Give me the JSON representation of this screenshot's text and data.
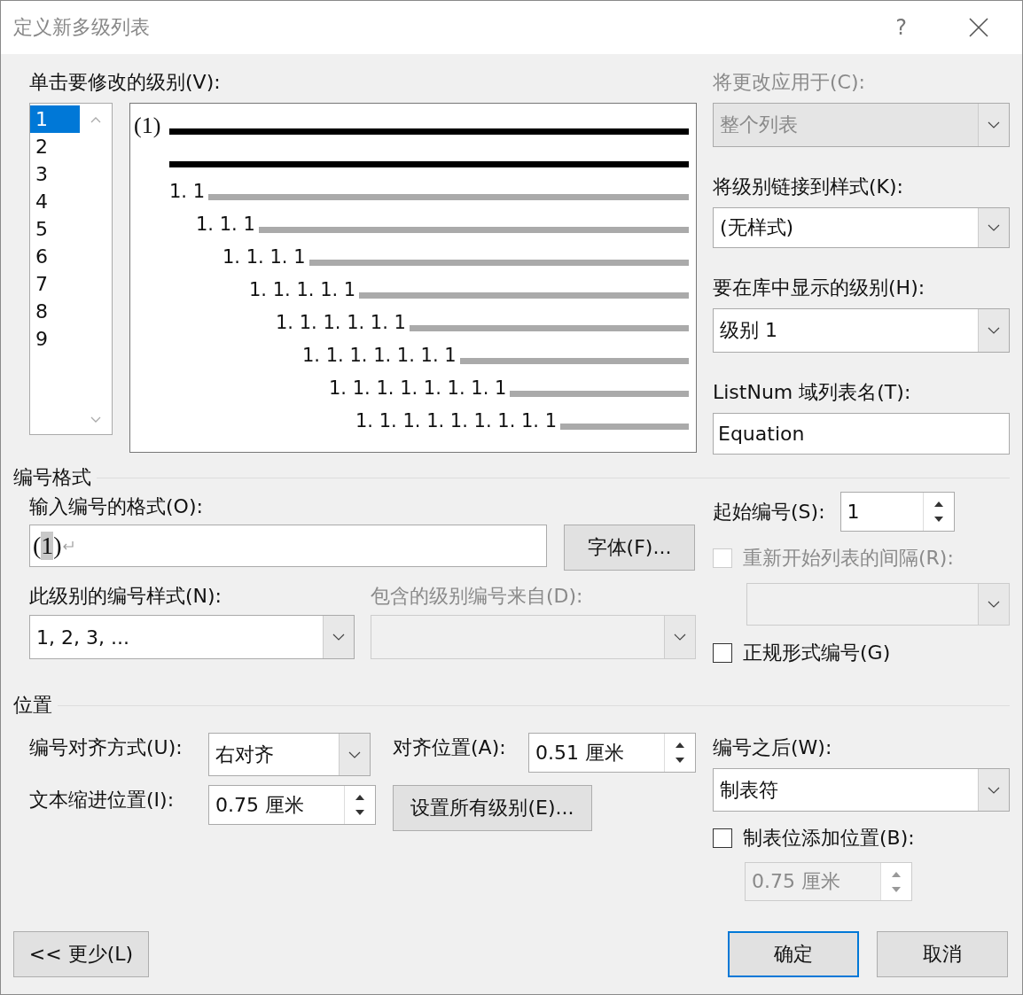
{
  "window": {
    "title": "定义新多级列表",
    "help": "?"
  },
  "level_picker": {
    "label": "单击要修改的级别(V):",
    "levels": [
      {
        "label": "1",
        "selected": true
      },
      {
        "label": "2",
        "selected": false
      },
      {
        "label": "3",
        "selected": false
      },
      {
        "label": "4",
        "selected": false
      },
      {
        "label": "5",
        "selected": false
      },
      {
        "label": "6",
        "selected": false
      },
      {
        "label": "7",
        "selected": false
      },
      {
        "label": "8",
        "selected": false
      },
      {
        "label": "9",
        "selected": false
      }
    ]
  },
  "preview": {
    "lines": [
      {
        "number": "(1)",
        "kind": "current"
      },
      {
        "kind": "current"
      },
      {
        "number": "1. 1",
        "kind": "other"
      },
      {
        "number": "1. 1. 1",
        "kind": "other"
      },
      {
        "number": "1. 1. 1. 1",
        "kind": "other"
      },
      {
        "number": "1. 1. 1. 1. 1",
        "kind": "other"
      },
      {
        "number": "1. 1. 1. 1. 1. 1",
        "kind": "other"
      },
      {
        "number": "1. 1. 1. 1. 1. 1. 1",
        "kind": "other"
      },
      {
        "number": "1. 1. 1. 1. 1. 1. 1. 1",
        "kind": "other"
      },
      {
        "number": "1. 1. 1. 1. 1. 1. 1. 1. 1",
        "kind": "other"
      }
    ]
  },
  "apply_to": {
    "label": "将更改应用于(C):",
    "value": "整个列表",
    "disabled": true
  },
  "link_style": {
    "label": "将级别链接到样式(K):",
    "value": "(无样式)"
  },
  "gallery_level": {
    "label": "要在库中显示的级别(H):",
    "value": "级别 1"
  },
  "listnum": {
    "label": "ListNum 域列表名(T):",
    "value": "Equation"
  },
  "number_format": {
    "title": "编号格式",
    "format_label": "输入编号的格式(O):",
    "format_parts": [
      {
        "text": "(",
        "kind": "literal"
      },
      {
        "text": "1",
        "kind": "field"
      },
      {
        "text": ")",
        "kind": "literal"
      }
    ],
    "font_button": "字体(F)...",
    "style_label": "此级别的编号样式(N):",
    "style_value": "1, 2, 3, ...",
    "include_label": "包含的级别编号来自(D):",
    "include_disabled": true,
    "start_label": "起始编号(S):",
    "start_value": "1",
    "restart": {
      "label": "重新开始列表的间隔(R):",
      "checked": false,
      "disabled": true
    },
    "legal": {
      "label": "正规形式编号(G)",
      "checked": false
    }
  },
  "position": {
    "title": "位置",
    "align_label": "编号对齐方式(U):",
    "align_value": "右对齐",
    "at_label": "对齐位置(A):",
    "at_value": "0.51 厘米",
    "indent_label": "文本缩进位置(I):",
    "indent_value": "0.75 厘米",
    "set_all_button": "设置所有级别(E)...",
    "follow_label": "编号之后(W):",
    "follow_value": "制表符",
    "tab_stop": {
      "label": "制表位添加位置(B):",
      "checked": false,
      "value": "0.75 厘米",
      "disabled": true
    }
  },
  "buttons": {
    "less": "<< 更少(L)",
    "ok": "确定",
    "cancel": "取消"
  }
}
